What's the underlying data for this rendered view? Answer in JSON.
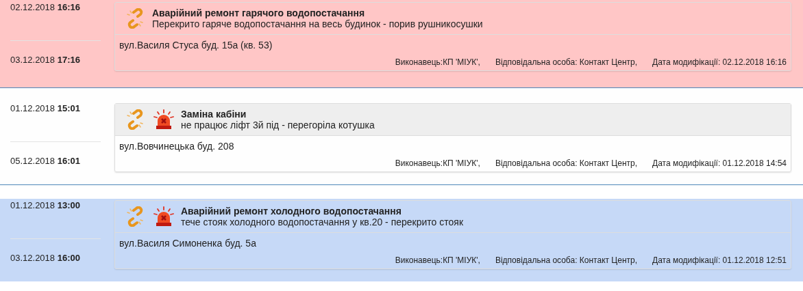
{
  "requests": [
    {
      "color": "#ffc6c6",
      "start": "02.12.2018 **16:16**",
      "end": "03.12.2018 **17:16**",
      "alarm": false,
      "title": "Аварійний ремонт гарячого водопостачання",
      "description": "Перекрито гаряче водопостачання на весь будинок - порив рушникосушки",
      "address": "вул.Василя Стуса буд. 15а (кв. 53)",
      "executor": "Виконавець:КП 'МІУК',",
      "responsible": "Відповідальна особа: Контакт Центр,",
      "modified": "Дата модифікації: 02.12.2018 16:16"
    },
    {
      "color": "#fefefe",
      "start": "01.12.2018 **15:01**",
      "end": "05.12.2018 **16:01**",
      "alarm": true,
      "title": "Заміна кабіни",
      "description": "не працює ліфт 3й під - перегоріла котушка",
      "address": "вул.Вовчинецька буд. 208",
      "executor": "Виконавець:КП 'МІУК',",
      "responsible": "Відповідальна особа: Контакт Центр,",
      "modified": "Дата модифікації: 01.12.2018 14:54"
    },
    {
      "color": "#c6d9f7",
      "start": "01.12.2018 **13:00**",
      "end": "03.12.2018 **16:00**",
      "alarm": true,
      "title": "Аварійний ремонт холодного водопостачання",
      "description": "тече стояк холодного водопостачання у кв.20 - перекрито стояк",
      "address": "вул.Василя Симоненка буд. 5а",
      "executor": "Виконавець:КП 'МІУК',",
      "responsible": "Відповідальна особа: Контакт Центр,",
      "modified": "Дата модифікації: 01.12.2018 12:51"
    }
  ]
}
